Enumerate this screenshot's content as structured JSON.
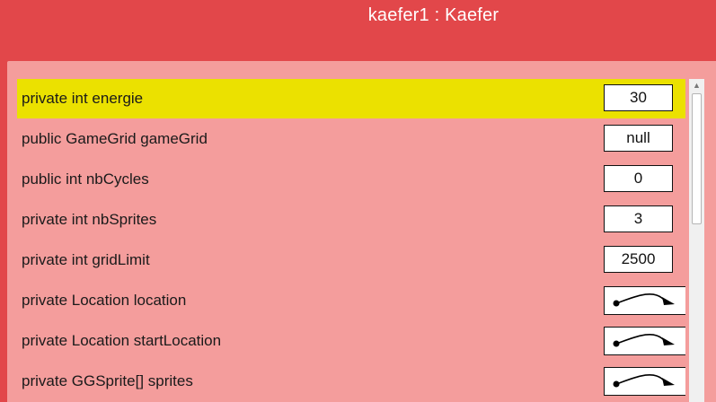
{
  "window": {
    "title": "kaefer1 : Kaefer"
  },
  "fields": [
    {
      "label": "private int energie",
      "value": "30",
      "kind": "value",
      "selected": true
    },
    {
      "label": "public GameGrid gameGrid",
      "value": "null",
      "kind": "value",
      "selected": false
    },
    {
      "label": "public int nbCycles",
      "value": "0",
      "kind": "value",
      "selected": false
    },
    {
      "label": "private int nbSprites",
      "value": "3",
      "kind": "value",
      "selected": false
    },
    {
      "label": "private int gridLimit",
      "value": "2500",
      "kind": "value",
      "selected": false
    },
    {
      "label": "private Location location",
      "icon": "object-reference-arrow-icon",
      "kind": "reference",
      "selected": false
    },
    {
      "label": "private Location startLocation",
      "icon": "object-reference-arrow-icon",
      "kind": "reference",
      "selected": false
    },
    {
      "label": "private GGSprite[] sprites",
      "icon": "object-reference-arrow-icon",
      "kind": "reference",
      "selected": false
    }
  ],
  "colors": {
    "titlebar": "#e2474a",
    "panel": "#f49d9c",
    "selection": "#ebe100"
  }
}
